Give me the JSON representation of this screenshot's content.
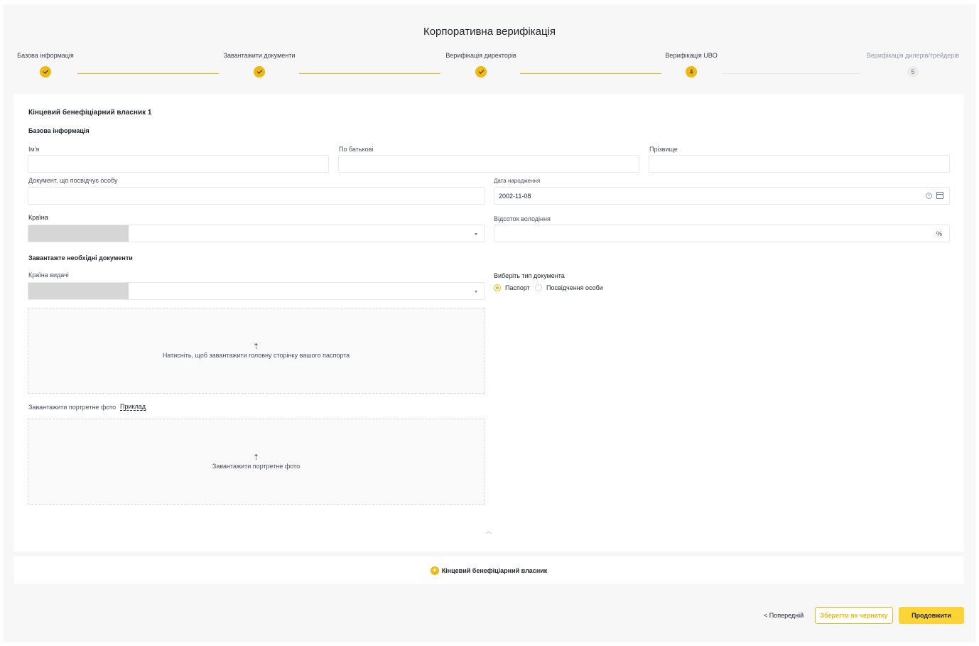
{
  "page": {
    "title": "Корпоративна верифікація"
  },
  "stepper": {
    "steps": [
      {
        "label": "Базова інформація",
        "status": "done",
        "marker": ""
      },
      {
        "label": "Завантажити документи",
        "status": "done",
        "marker": ""
      },
      {
        "label": "Верифікація директорів",
        "status": "done",
        "marker": ""
      },
      {
        "label": "Верифікація UBO",
        "status": "active",
        "marker": "4"
      },
      {
        "label": "Верифікація дилерів/трейдерів",
        "status": "pending",
        "marker": "5"
      }
    ]
  },
  "form": {
    "section_title": "Кінцевий бенефіціарний власник 1",
    "basic_info_heading": "Базова інформація",
    "first_name": {
      "label": "Ім'я",
      "value": ""
    },
    "middle_name": {
      "label": "По батькові",
      "value": ""
    },
    "last_name": {
      "label": "Прізвище",
      "value": ""
    },
    "id_document": {
      "label": "Документ, що посвідчує особу",
      "value": ""
    },
    "birth_date": {
      "label": "Дата народження",
      "value": "2002-11-08"
    },
    "country": {
      "label": "Країна",
      "value": ""
    },
    "ownership": {
      "label": "Відсоток володіння",
      "value": "",
      "suffix": "%"
    },
    "upload_heading": "Завантажте необхідні документи",
    "issuing_country": {
      "label": "Країна видачі",
      "value": ""
    },
    "doc_type": {
      "label": "Виберіть тип документа",
      "options": [
        "Паспорт",
        "Посвідчення особи"
      ],
      "selected": "Паспорт"
    },
    "passport_upload_text": "Натисніть, щоб завантажити головну сторінку вашого паспорта",
    "portrait_label": "Завантажити портретне фото",
    "example_link": "Приклад",
    "portrait_upload_text": "Завантажити портретне фото"
  },
  "add_owner": {
    "label": "Кінцевий бенефіціарний власник"
  },
  "footer": {
    "prev_label": "< Попередній",
    "draft_label": "Зберегти як чернетку",
    "next_label": "Продовжити"
  },
  "colors": {
    "accent": "#f0b90b",
    "primary_button": "#fcd535"
  },
  "icons": [
    "check-icon",
    "calendar-icon",
    "clear-icon",
    "chevron-down-icon",
    "upload-icon",
    "chevron-up-icon",
    "plus-circle-icon"
  ]
}
